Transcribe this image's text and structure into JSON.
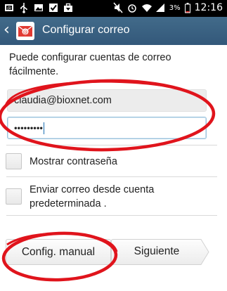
{
  "status_bar": {
    "battery_percent": "3%",
    "time": "12:16"
  },
  "action_bar": {
    "title": "Configurar correo"
  },
  "content": {
    "description": "Puede configurar cuentas de correo fácilmente.",
    "email_value": "claudia@bioxnet.com",
    "password_mask": "•••••••••",
    "show_password_label": "Mostrar contraseña",
    "show_password_checked": false,
    "default_account_label_line1": "Enviar correo desde cuenta",
    "default_account_label_line2": "predeterminada .",
    "default_account_checked": false
  },
  "buttons": {
    "manual_label": "Config. manual",
    "next_label": "Siguiente"
  },
  "colors": {
    "action_bar": "#3b6384",
    "annotation": "#e0141c"
  },
  "icons": [
    "usb-icon",
    "image-icon",
    "check-icon",
    "briefcase-icon",
    "mute-icon",
    "alarm-icon",
    "wifi-icon",
    "signal-icon",
    "battery-icon",
    "back-chevron-icon",
    "email-app-icon"
  ]
}
